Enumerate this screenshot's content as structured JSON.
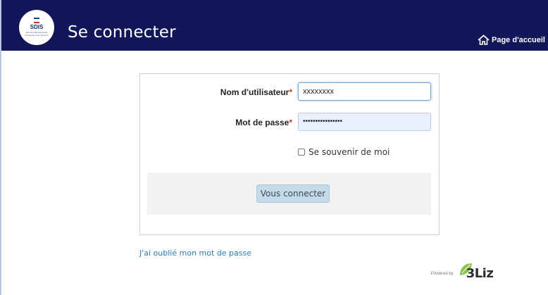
{
  "header": {
    "title": "Se connecter",
    "home_link": "Page d'accueil",
    "logo_text": "SDIS",
    "logo_subtext": "Service Départemental d'Incendie et de Secours",
    "background_color": "#101657"
  },
  "form": {
    "username_label": "Nom d'utilisateur",
    "username_value": "xxxxxxxx",
    "password_label": "Mot de passe",
    "password_value": "••••••••••••••••",
    "required_marker": "*",
    "remember_label": "Se souvenir de moi",
    "remember_checked": false,
    "submit_label": "Vous connecter"
  },
  "footer": {
    "forgot_link": "J'ai oublié mon mot de passe",
    "powered_by": "Powered by",
    "brand": "3Liz"
  },
  "colors": {
    "accent": "#2a7bb5",
    "button_bg": "#c5dbea",
    "required": "#c0392b"
  },
  "icons": {
    "home": "home-icon",
    "brand_leaf": "leaf-icon"
  }
}
